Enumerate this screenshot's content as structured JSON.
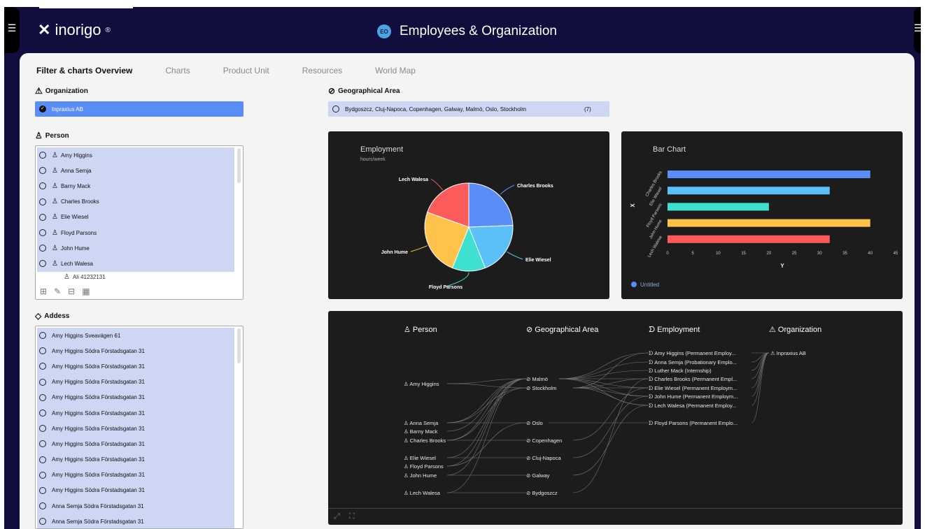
{
  "header": {
    "logo_text": "inorigo",
    "logo_mark": "®",
    "app_badge": "EO",
    "app_title": "Employees & Organization"
  },
  "tabs": [
    "Filter & charts Overview",
    "Charts",
    "Product Unit",
    "Resources",
    "World Map"
  ],
  "organization": {
    "title": "Organization",
    "selected": "Inpraxius AB"
  },
  "geo_area": {
    "title": "Geographical Area",
    "selected": "Bydgoszcz, Cluj-Napoca, Copenhagen, Galway, Malmö, Oslo, Stockholm",
    "count": "(7)"
  },
  "person": {
    "title": "Person",
    "items": [
      "Amy Higgins",
      "Anna Semja",
      "Barny Mack",
      "Charles Brooks",
      "Elie Wiesel",
      "Floyd Parsons",
      "John Hume",
      "Lech Walesa"
    ],
    "extra": "Ali 41232131"
  },
  "address": {
    "title": "Addess",
    "items": [
      "Amy Higgins Sveavägen 61",
      "Amy Higgins Södra Förstadsgatan 31",
      "Amy Higgins Södra Förstadsgatan 31",
      "Amy Higgins Södra Förstadsgatan 31",
      "Amy Higgins Södra Förstadsgatan 31",
      "Amy Higgins Södra Förstadsgatan 31",
      "Amy Higgins Södra Förstadsgatan 31",
      "Amy Higgins Södra Förstadsgatan 31",
      "Amy Higgins Södra Förstadsgatan 31",
      "Amy Higgins Södra Förstadsgatan 31",
      "Amy Higgins Södra Förstadsgatan 31",
      "Anna Semja Södra Förstadsgatan 31",
      "Anna Semja Södra Förstadsgatan 31"
    ]
  },
  "chart_data": [
    {
      "type": "pie",
      "title": "Employment",
      "subtitle": "hours/week",
      "slices": [
        {
          "label": "Charles Brooks",
          "value": 40,
          "color": "#5b8df6"
        },
        {
          "label": "Elie Wiesel",
          "value": 32,
          "color": "#5bc0f8"
        },
        {
          "label": "Floyd Parsons",
          "value": 20,
          "color": "#3ee0d0"
        },
        {
          "label": "John Hume",
          "value": 40,
          "color": "#ffc24b"
        },
        {
          "label": "Lech Walesa",
          "value": 32,
          "color": "#fb5b5b"
        }
      ]
    },
    {
      "type": "bar",
      "orientation": "horizontal",
      "title": "Bar Chart",
      "xlabel": "Y",
      "ylabel": "X",
      "categories": [
        "Charles Brooks",
        "Elie Wiesel",
        "Floyd Parsons",
        "John Hume",
        "Lech Walesa"
      ],
      "values": [
        40,
        32,
        20,
        40,
        32
      ],
      "colors": [
        "#5b8df6",
        "#5bc0f8",
        "#3ee0d0",
        "#ffc24b",
        "#fb5b5b"
      ],
      "xlim": [
        0,
        45
      ],
      "ticks": [
        "0",
        "5",
        "10",
        "15",
        "20",
        "25",
        "30",
        "35",
        "40",
        "45"
      ],
      "legend": "Untitled",
      "legend_color": "#5b8df6"
    }
  ],
  "graph": {
    "columns": [
      "Person",
      "Geographical Area",
      "Employment",
      "Organization"
    ],
    "persons": [
      "Amy Higgins",
      "Anna Semja",
      "Barny Mack",
      "Charles Brooks",
      "Elie Wiesel",
      "Floyd Parsons",
      "John Hume",
      "Lech Walesa"
    ],
    "areas": [
      "Malmö",
      "Stockholm",
      "Oslo",
      "Copenhagen",
      "Cluj-Napoca",
      "Galway",
      "Bydgoszcz"
    ],
    "employments": [
      "Amy Higgins (Permanent Employ...",
      "Anna Semja (Probationary Emplo...",
      "Luther Mack (Internship)",
      "Charles Brooks (Permanent Empl...",
      "Elie Wiesel (Permanent Employm...",
      "John Hume (Permanent Employm...",
      "Lech Walesa (Permanent Employ...",
      "Floyd Parsons (Permanent Emplo..."
    ],
    "organization": "Inpraxius AB"
  }
}
